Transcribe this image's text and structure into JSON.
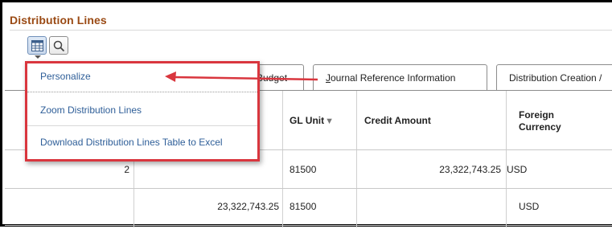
{
  "section": {
    "title": "Distribution Lines"
  },
  "toolbar": {
    "personalize_icon": "grid-settings-icon",
    "search_icon": "search-icon"
  },
  "tabs": [
    {
      "label": "Budget"
    },
    {
      "label_underline": "J",
      "label_rest": "ournal Reference Information"
    },
    {
      "label": "Distribution Creation /"
    }
  ],
  "menu": {
    "items": [
      {
        "label": "Personalize"
      },
      {
        "label": "Zoom Distribution Lines"
      },
      {
        "label": "Download Distribution Lines Table to Excel"
      }
    ]
  },
  "table": {
    "columns": [
      {
        "label": "GL Unit",
        "sort_icon": "▼"
      },
      {
        "label": "Credit Amount"
      },
      {
        "label_line1": "Foreign",
        "label_line2": "Currency"
      }
    ],
    "rows": [
      {
        "line": "2",
        "amount_col": "",
        "gl_unit": "81500",
        "credit_amount": "23,322,743.25",
        "currency": "USD"
      },
      {
        "line": "",
        "amount_col": "23,322,743.25",
        "gl_unit": "81500",
        "credit_amount": "",
        "currency": "USD"
      }
    ]
  },
  "colors": {
    "title": "#9a4a14",
    "link": "#2e5e98",
    "highlight": "#d9363e"
  }
}
